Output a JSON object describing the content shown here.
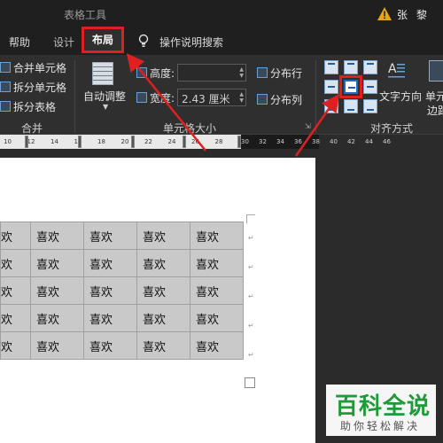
{
  "titlebar": {
    "context_title": "表格工具",
    "user_name": "张 黎"
  },
  "tabs": {
    "help": "帮助",
    "design": "设计",
    "layout": "布局",
    "search": "操作说明搜索"
  },
  "merge_group": {
    "merge_cells": "合并单元格",
    "split_cells": "拆分单元格",
    "split_table": "拆分表格",
    "label": "合并"
  },
  "autofit": {
    "label": "自动调整"
  },
  "cell_size": {
    "height_label": "高度:",
    "height_value": "",
    "width_label": "宽度:",
    "width_value": "2.43 厘米",
    "distribute_rows": "分布行",
    "distribute_cols": "分布列",
    "label": "单元格大小"
  },
  "alignment": {
    "label": "对齐方式",
    "text_direction": "文字方向",
    "cell_margins": [
      "单元",
      "边距"
    ],
    "selected": "center"
  },
  "ruler": {
    "ticks_light": [
      "10",
      "12",
      "14",
      "16",
      "18",
      "20",
      "22",
      "24",
      "26",
      "28"
    ],
    "ticks_dark": [
      "30",
      "32",
      "34",
      "36",
      "38",
      "40",
      "42",
      "44",
      "46"
    ]
  },
  "table": {
    "rows": [
      [
        "欢",
        "喜欢",
        "喜欢",
        "喜欢",
        "喜欢"
      ],
      [
        "欢",
        "喜欢",
        "喜欢",
        "喜欢",
        "喜欢"
      ],
      [
        "欢",
        "喜欢",
        "喜欢",
        "喜欢",
        "喜欢"
      ],
      [
        "欢",
        "喜欢",
        "喜欢",
        "喜欢",
        "喜欢"
      ],
      [
        "欢",
        "喜欢",
        "喜欢",
        "喜欢",
        "喜欢"
      ]
    ]
  },
  "watermark": {
    "title": "百科全说",
    "subtitle": "助你轻松解决"
  },
  "colors": {
    "highlight": "#e02020",
    "ribbon_bg": "#2f2f2f",
    "titlebar_bg": "#1f1f1f",
    "watermark_green": "#1ea03a"
  }
}
